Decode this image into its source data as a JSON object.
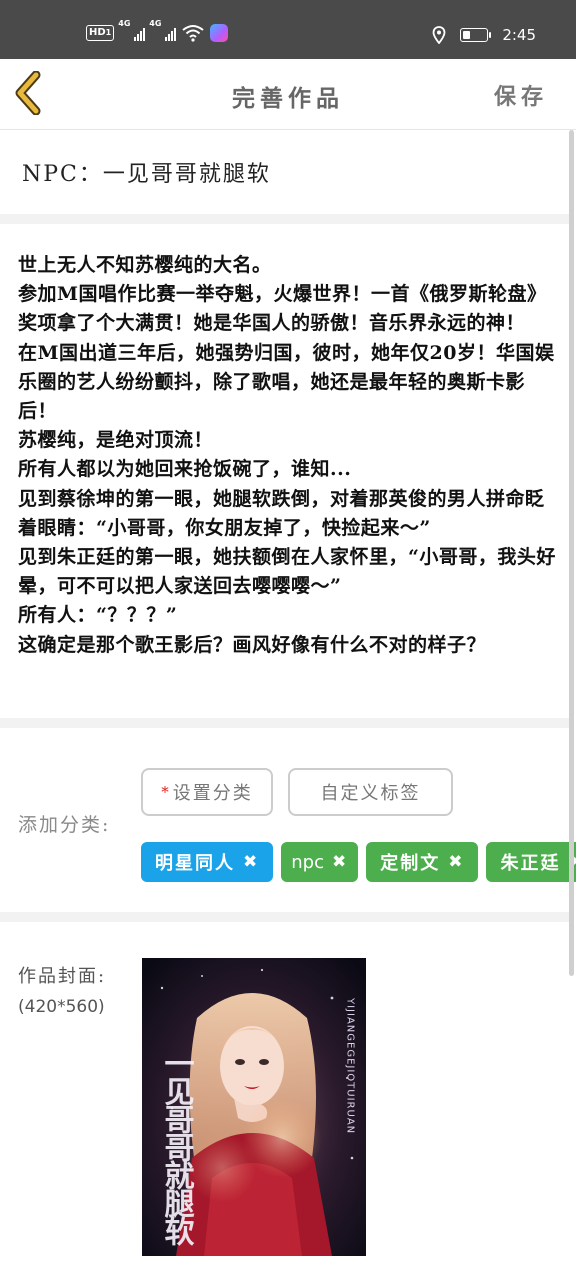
{
  "status_bar": {
    "hd": "HD",
    "sim1": "1",
    "net1": "4G",
    "net2": "4G",
    "time": "2:45",
    "battery_level": 0.3
  },
  "nav": {
    "back_icon": "chevron-left-icon",
    "title": "完善作品",
    "save_label": "保存",
    "accent": "#e8b93a"
  },
  "work": {
    "title": "NPC：一见哥哥就腿软"
  },
  "summary": {
    "lines": [
      "世上无人不知苏樱纯的大名。",
      "参加M国唱作比赛一举夺魁，火爆世界！一首《俄罗斯轮盘》奖项拿了个大满贯！她是华国人的骄傲！音乐界永远的神！",
      "在M国出道三年后，她强势归国，彼时，她年仅20岁！华国娱乐圈的艺人纷纷颤抖，除了歌唱，她还是最年轻的奥斯卡影后！",
      "苏樱纯，是绝对顶流！",
      "所有人都以为她回来抢饭碗了，谁知...",
      "见到蔡徐坤的第一眼，她腿软跌倒，对着那英俊的男人拼命眨着眼睛：“小哥哥，你女朋友掉了，快捡起来～”",
      "见到朱正廷的第一眼，她扶额倒在人家怀里，“小哥哥，我头好晕，可不可以把人家送回去嘤嘤嘤～”",
      "所有人：“？？？”",
      "这确定是那个歌王影后？画风好像有什么不对的样子？"
    ]
  },
  "category": {
    "label": "添加分类:",
    "required_mark": "*",
    "set_category_label": "设置分类",
    "custom_tag_label": "自定义标签",
    "tags": [
      {
        "label": "明星同人",
        "color": "#1aa3e8"
      },
      {
        "label": "npc",
        "color": "#4cae4c"
      },
      {
        "label": "定制文",
        "color": "#4cae4c"
      },
      {
        "label": "朱正廷",
        "color": "#4cae4c"
      }
    ],
    "remove_icon": "close-icon"
  },
  "cover": {
    "label": "作品封面:",
    "size_hint": "(420*560)",
    "art_text_vertical": "一见哥哥就腿软",
    "art_text_pinyin": "YIJIANGEGEJIOTUIRUAN"
  }
}
